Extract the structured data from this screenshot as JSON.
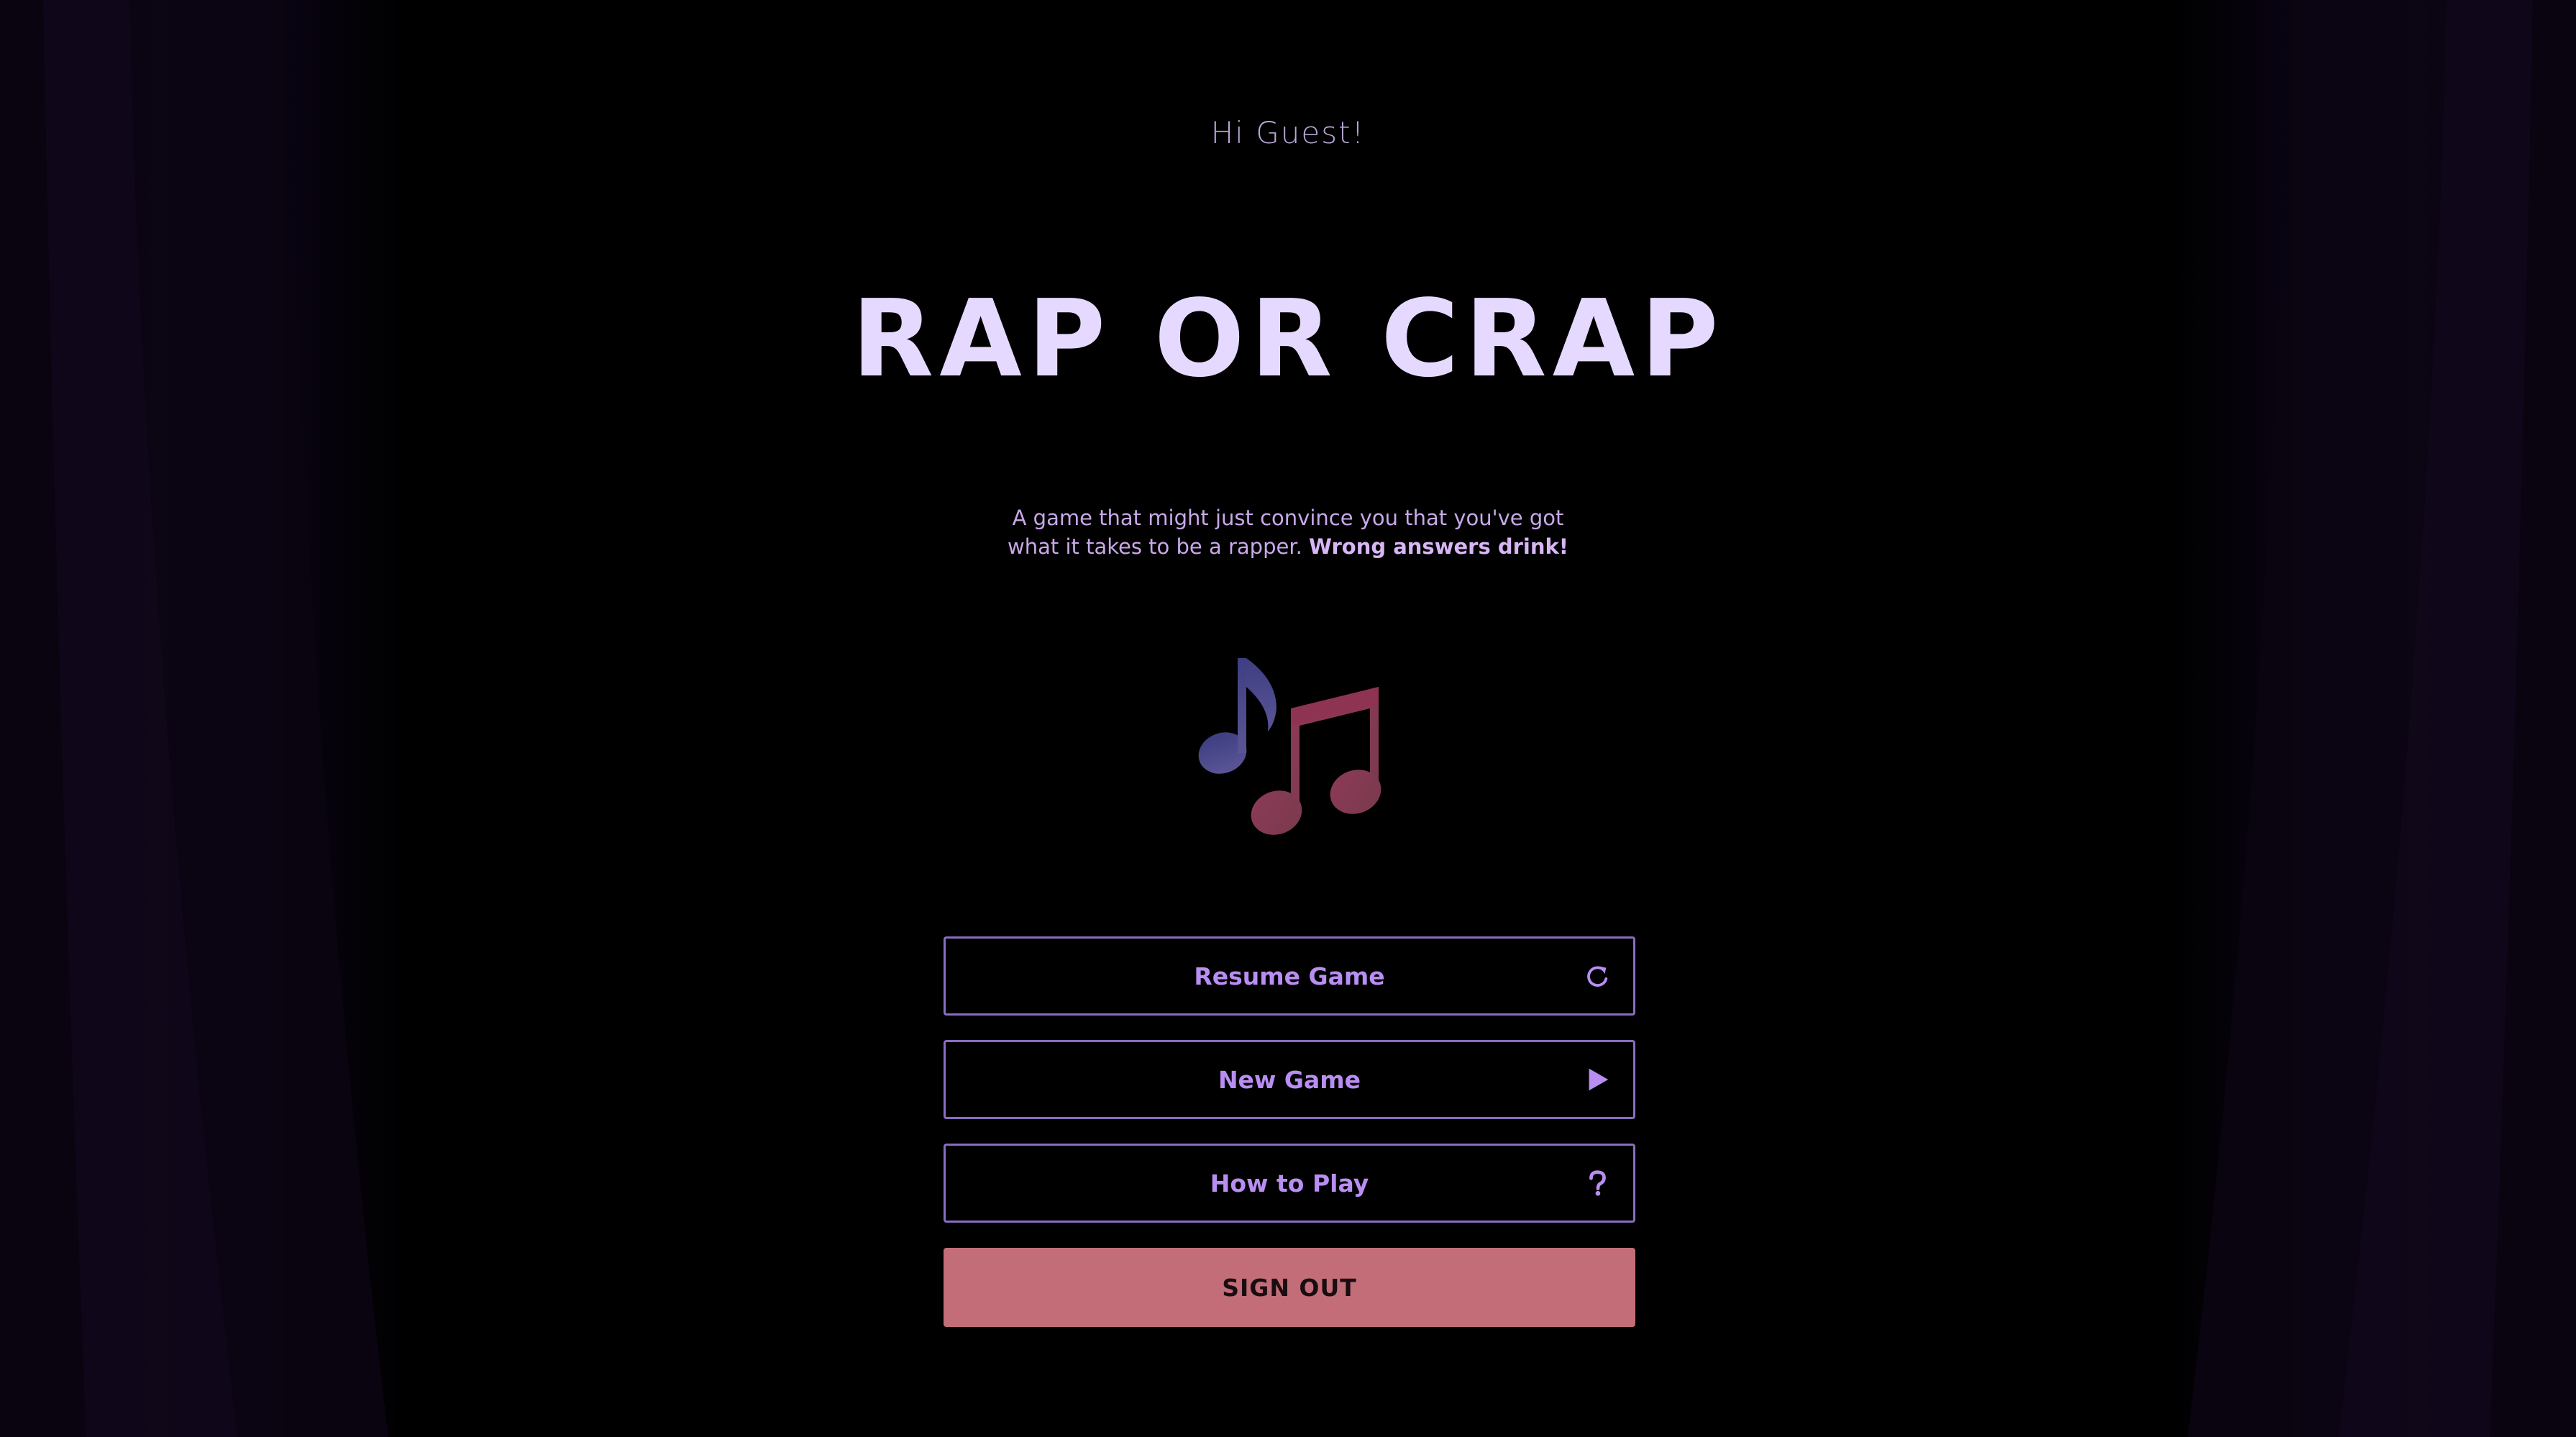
{
  "greeting": "Hi Guest!",
  "title": "RAP OR CRAP",
  "tagline": {
    "text": "A game that might just convince you that you've got what it takes to be a rapper.",
    "emphasis": "Wrong answers drink!"
  },
  "logo": {
    "icon": "music-notes-icon",
    "colors": {
      "left_note": "#4e4a8a",
      "right_note": "#8a3850"
    }
  },
  "menu": {
    "resume": {
      "label": "Resume Game",
      "icon": "refresh-icon"
    },
    "new_game": {
      "label": "New Game",
      "icon": "play-icon"
    },
    "how_to_play": {
      "label": "How to Play",
      "icon": "question-icon"
    },
    "sign_out": {
      "label": "SIGN OUT"
    }
  },
  "colors": {
    "accent": "#b98ef2",
    "border": "#8a6cc4",
    "title": "#e6d9ff",
    "sign_out_bg": "#c36d78",
    "background": "#000000"
  }
}
